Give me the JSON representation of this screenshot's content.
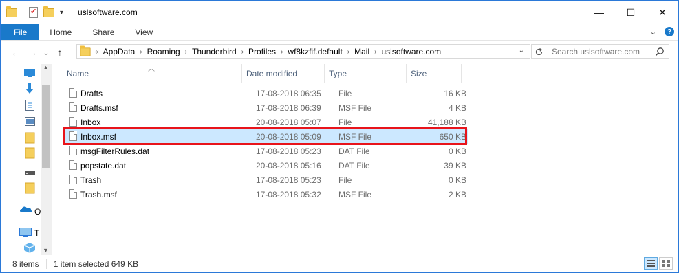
{
  "window": {
    "title": "uslsoftware.com",
    "controls": {
      "minimize": "—",
      "maximize": "☐",
      "close": "✕"
    }
  },
  "ribbon": {
    "tabs": [
      "File",
      "Home",
      "Share",
      "View"
    ],
    "expand_icon": "chevron-down-icon",
    "help_label": "?"
  },
  "nav": {
    "back_icon": "←",
    "forward_icon": "→",
    "recent_icon": "⌄",
    "up_icon": "↑"
  },
  "address": {
    "overflow": "«",
    "breadcrumbs": [
      "AppData",
      "Roaming",
      "Thunderbird",
      "Profiles",
      "wf8kzfif.default",
      "Mail",
      "uslsoftware.com"
    ],
    "separator": "›"
  },
  "search": {
    "placeholder": "Search uslsoftware.com"
  },
  "navpane": {
    "labels": {
      "onedrive": "O",
      "thispc": "T"
    }
  },
  "columns": {
    "name": "Name",
    "date": "Date modified",
    "type": "Type",
    "size": "Size"
  },
  "files": [
    {
      "name": "Drafts",
      "date": "17-08-2018 06:35",
      "type": "File",
      "size": "16 KB"
    },
    {
      "name": "Drafts.msf",
      "date": "17-08-2018 06:39",
      "type": "MSF File",
      "size": "4 KB"
    },
    {
      "name": "Inbox",
      "date": "20-08-2018 05:07",
      "type": "File",
      "size": "41,188 KB"
    },
    {
      "name": "Inbox.msf",
      "date": "20-08-2018 05:09",
      "type": "MSF File",
      "size": "650 KB"
    },
    {
      "name": "msgFilterRules.dat",
      "date": "17-08-2018 05:23",
      "type": "DAT File",
      "size": "0 KB"
    },
    {
      "name": "popstate.dat",
      "date": "20-08-2018 05:16",
      "type": "DAT File",
      "size": "39 KB"
    },
    {
      "name": "Trash",
      "date": "17-08-2018 05:23",
      "type": "File",
      "size": "0 KB"
    },
    {
      "name": "Trash.msf",
      "date": "17-08-2018 05:32",
      "type": "MSF File",
      "size": "2 KB"
    }
  ],
  "selected_file": "Inbox.msf",
  "status": {
    "items": "8 items",
    "selection": "1 item selected  649 KB"
  },
  "colors": {
    "accent": "#1979ca",
    "selection": "#cce8ff",
    "highlight": "#e8141b"
  }
}
